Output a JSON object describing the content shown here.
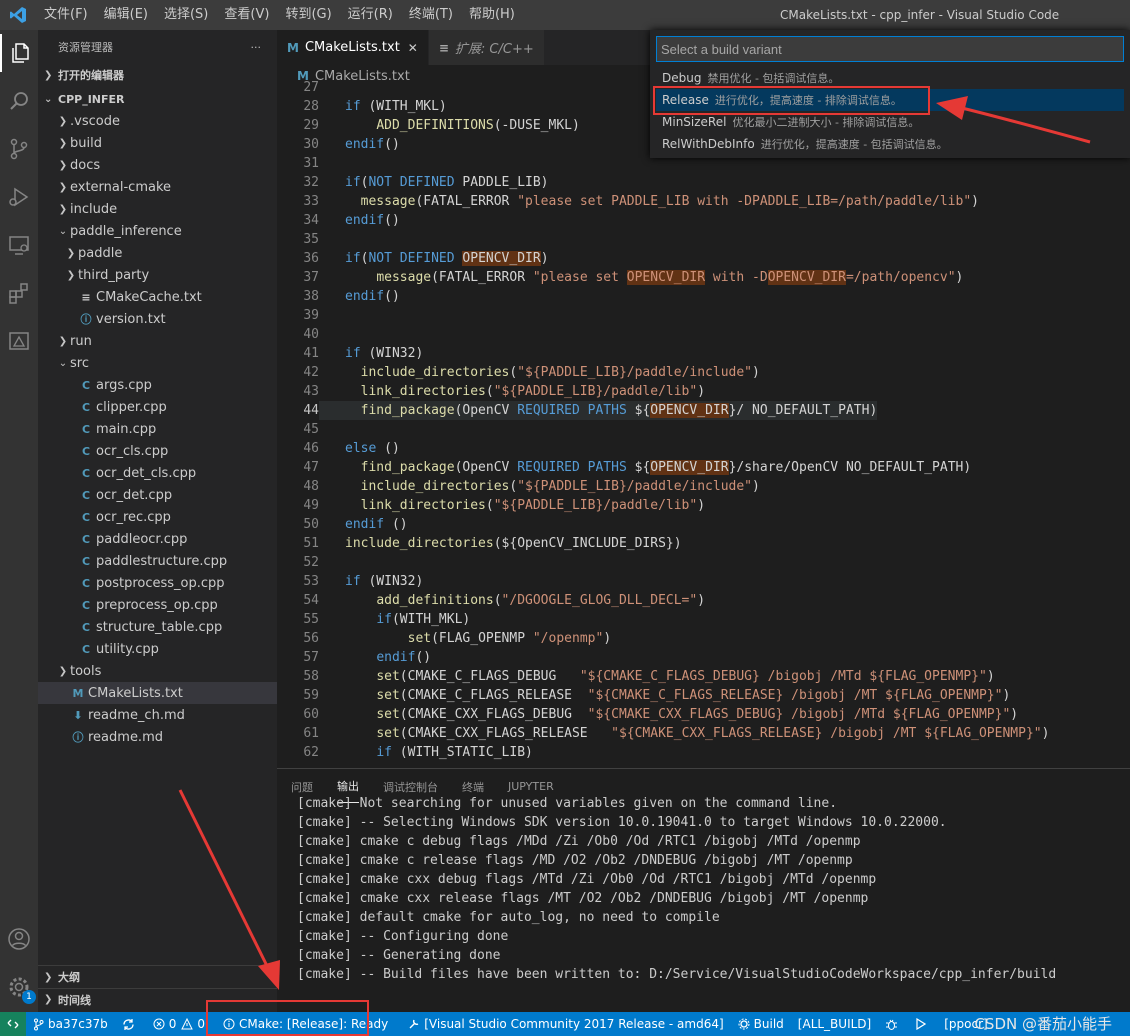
{
  "titlebar": {
    "menus": [
      "文件(F)",
      "编辑(E)",
      "选择(S)",
      "查看(V)",
      "转到(G)",
      "运行(R)",
      "终端(T)",
      "帮助(H)"
    ],
    "window_title": "CMakeLists.txt - cpp_infer - Visual Studio Code"
  },
  "sidebar": {
    "header": "资源管理器",
    "more": "···",
    "open_editors": "打开的编辑器",
    "workspace": "CPP_INFER",
    "tree": [
      {
        "label": ".vscode",
        "type": "folder",
        "depth": 1
      },
      {
        "label": "build",
        "type": "folder",
        "depth": 1
      },
      {
        "label": "docs",
        "type": "folder",
        "depth": 1
      },
      {
        "label": "external-cmake",
        "type": "folder",
        "depth": 1
      },
      {
        "label": "include",
        "type": "folder",
        "depth": 1
      },
      {
        "label": "paddle_inference",
        "type": "folder-open",
        "depth": 1
      },
      {
        "label": "paddle",
        "type": "folder",
        "depth": 2
      },
      {
        "label": "third_party",
        "type": "folder",
        "depth": 2
      },
      {
        "label": "CMakeCache.txt",
        "type": "txt",
        "depth": 2
      },
      {
        "label": "version.txt",
        "type": "info",
        "depth": 2
      },
      {
        "label": "run",
        "type": "folder",
        "depth": 1
      },
      {
        "label": "src",
        "type": "folder-open",
        "depth": 1
      },
      {
        "label": "args.cpp",
        "type": "cpp",
        "depth": 2
      },
      {
        "label": "clipper.cpp",
        "type": "cpp",
        "depth": 2
      },
      {
        "label": "main.cpp",
        "type": "cpp",
        "depth": 2
      },
      {
        "label": "ocr_cls.cpp",
        "type": "cpp",
        "depth": 2
      },
      {
        "label": "ocr_det_cls.cpp",
        "type": "cpp",
        "depth": 2
      },
      {
        "label": "ocr_det.cpp",
        "type": "cpp",
        "depth": 2
      },
      {
        "label": "ocr_rec.cpp",
        "type": "cpp",
        "depth": 2
      },
      {
        "label": "paddleocr.cpp",
        "type": "cpp",
        "depth": 2
      },
      {
        "label": "paddlestructure.cpp",
        "type": "cpp",
        "depth": 2
      },
      {
        "label": "postprocess_op.cpp",
        "type": "cpp",
        "depth": 2
      },
      {
        "label": "preprocess_op.cpp",
        "type": "cpp",
        "depth": 2
      },
      {
        "label": "structure_table.cpp",
        "type": "cpp",
        "depth": 2
      },
      {
        "label": "utility.cpp",
        "type": "cpp",
        "depth": 2
      },
      {
        "label": "tools",
        "type": "folder",
        "depth": 1
      },
      {
        "label": "CMakeLists.txt",
        "type": "cmake",
        "depth": 1,
        "active": true
      },
      {
        "label": "readme_ch.md",
        "type": "md",
        "depth": 1
      },
      {
        "label": "readme.md",
        "type": "info",
        "depth": 1
      }
    ],
    "outline": "大纲",
    "timeline": "时间线"
  },
  "editor": {
    "tabs": [
      {
        "label": "CMakeLists.txt",
        "active": true
      },
      {
        "label": "扩展: C/C++",
        "active": false
      }
    ],
    "breadcrumb": "CMakeLists.txt",
    "lines": [
      {
        "n": "27",
        "text": ""
      },
      {
        "n": "28",
        "text": "if (WITH_MKL)"
      },
      {
        "n": "29",
        "text": "    ADD_DEFINITIONS(-DUSE_MKL)"
      },
      {
        "n": "30",
        "text": "endif()"
      },
      {
        "n": "31",
        "text": ""
      },
      {
        "n": "32",
        "text": "if(NOT DEFINED PADDLE_LIB)"
      },
      {
        "n": "33",
        "text": "  message(FATAL_ERROR \"please set PADDLE_LIB with -DPADDLE_LIB=/path/paddle/lib\")"
      },
      {
        "n": "34",
        "text": "endif()"
      },
      {
        "n": "35",
        "text": ""
      },
      {
        "n": "36",
        "text": "if(NOT DEFINED OPENCV_DIR)"
      },
      {
        "n": "37",
        "text": "    message(FATAL_ERROR \"please set OPENCV_DIR with -DOPENCV_DIR=/path/opencv\")"
      },
      {
        "n": "38",
        "text": "endif()"
      },
      {
        "n": "39",
        "text": ""
      },
      {
        "n": "40",
        "text": ""
      },
      {
        "n": "41",
        "text": "if (WIN32)"
      },
      {
        "n": "42",
        "text": "  include_directories(\"${PADDLE_LIB}/paddle/include\")"
      },
      {
        "n": "43",
        "text": "  link_directories(\"${PADDLE_LIB}/paddle/lib\")"
      },
      {
        "n": "44",
        "text": "  find_package(OpenCV REQUIRED PATHS ${OPENCV_DIR}/ NO_DEFAULT_PATH)"
      },
      {
        "n": "45",
        "text": ""
      },
      {
        "n": "46",
        "text": "else ()"
      },
      {
        "n": "47",
        "text": "  find_package(OpenCV REQUIRED PATHS ${OPENCV_DIR}/share/OpenCV NO_DEFAULT_PATH)"
      },
      {
        "n": "48",
        "text": "  include_directories(\"${PADDLE_LIB}/paddle/include\")"
      },
      {
        "n": "49",
        "text": "  link_directories(\"${PADDLE_LIB}/paddle/lib\")"
      },
      {
        "n": "50",
        "text": "endif ()"
      },
      {
        "n": "51",
        "text": "include_directories(${OpenCV_INCLUDE_DIRS})"
      },
      {
        "n": "52",
        "text": ""
      },
      {
        "n": "53",
        "text": "if (WIN32)"
      },
      {
        "n": "54",
        "text": "    add_definitions(\"/DGOOGLE_GLOG_DLL_DECL=\")"
      },
      {
        "n": "55",
        "text": "    if(WITH_MKL)"
      },
      {
        "n": "56",
        "text": "        set(FLAG_OPENMP \"/openmp\")"
      },
      {
        "n": "57",
        "text": "    endif()"
      },
      {
        "n": "58",
        "text": "    set(CMAKE_C_FLAGS_DEBUG   \"${CMAKE_C_FLAGS_DEBUG} /bigobj /MTd ${FLAG_OPENMP}\")"
      },
      {
        "n": "59",
        "text": "    set(CMAKE_C_FLAGS_RELEASE  \"${CMAKE_C_FLAGS_RELEASE} /bigobj /MT ${FLAG_OPENMP}\")"
      },
      {
        "n": "60",
        "text": "    set(CMAKE_CXX_FLAGS_DEBUG  \"${CMAKE_CXX_FLAGS_DEBUG} /bigobj /MTd ${FLAG_OPENMP}\")"
      },
      {
        "n": "61",
        "text": "    set(CMAKE_CXX_FLAGS_RELEASE   \"${CMAKE_CXX_FLAGS_RELEASE} /bigobj /MT ${FLAG_OPENMP}\")"
      },
      {
        "n": "62",
        "text": "    if (WITH_STATIC_LIB)"
      }
    ]
  },
  "quickpick": {
    "placeholder": "Select a build variant",
    "items": [
      {
        "label": "Debug",
        "desc": "禁用优化 - 包括调试信息。",
        "selected": false
      },
      {
        "label": "Release",
        "desc": "进行优化，提高速度 - 排除调试信息。",
        "selected": true
      },
      {
        "label": "MinSizeRel",
        "desc": "优化最小二进制大小 - 排除调试信息。",
        "selected": false
      },
      {
        "label": "RelWithDebInfo",
        "desc": "进行优化，提高速度 - 包括调试信息。",
        "selected": false
      }
    ]
  },
  "panel": {
    "tabs": [
      "问题",
      "输出",
      "调试控制台",
      "终端",
      "JUPYTER"
    ],
    "active_tab": "输出",
    "lines": [
      "[cmake] Not searching for unused variables given on the command line.",
      "[cmake] -- Selecting Windows SDK version 10.0.19041.0 to target Windows 10.0.22000.",
      "[cmake] cmake c debug flags /MDd /Zi /Ob0 /Od /RTC1 /bigobj /MTd /openmp",
      "[cmake] cmake c release flags /MD /O2 /Ob2 /DNDEBUG /bigobj /MT /openmp",
      "[cmake] cmake cxx debug flags /MTd /Zi /Ob0 /Od /RTC1 /bigobj /MTd /openmp",
      "[cmake] cmake cxx release flags /MT /O2 /Ob2 /DNDEBUG /bigobj /MT /openmp",
      "[cmake] default cmake for auto_log, no need to compile",
      "[cmake] -- Configuring done",
      "[cmake] -- Generating done",
      "[cmake] -- Build files have been written to: D:/Service/VisualStudioCodeWorkspace/cpp_infer/build"
    ]
  },
  "statusbar": {
    "branch": "ba37c37b",
    "errors": "0",
    "warnings": "0",
    "cmake_status": "CMake: [Release]: Ready",
    "kit": "[Visual Studio Community 2017 Release - amd64]",
    "build": "Build",
    "target": "[ALL_BUILD]",
    "launch_target": "[ppocr]",
    "watermark": "CSDN @番茄小能手"
  },
  "accounts_badge": "1",
  "colors": {
    "accent": "#007acc",
    "annotation_red": "#e53935",
    "string": "#ce9178",
    "keyword": "#569cd6",
    "function": "#dcdcaa"
  }
}
